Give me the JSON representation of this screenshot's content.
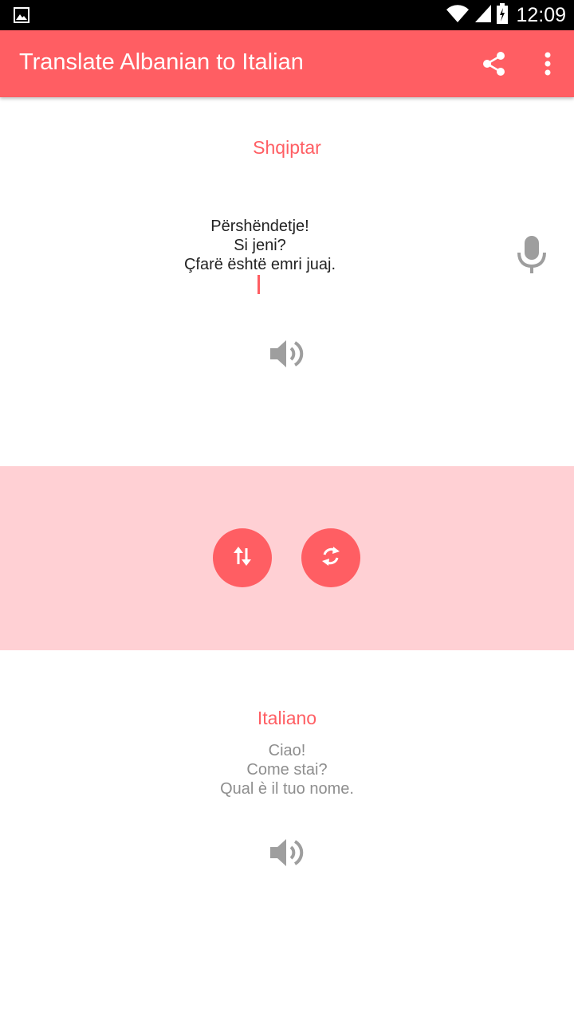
{
  "status_bar": {
    "time": "12:09",
    "icons": [
      "image-icon",
      "wifi-icon",
      "signal-icon",
      "battery-charging-icon"
    ]
  },
  "app_bar": {
    "title": "Translate Albanian to Italian",
    "actions": [
      "share-icon",
      "more-vert-icon"
    ],
    "background": "#ff5e63"
  },
  "source": {
    "language": "Shqiptar",
    "lines": [
      "Përshëndetje!",
      "Si jeni?",
      "Çfarë është emri juaj."
    ],
    "icons": [
      "mic-icon",
      "speaker-icon"
    ]
  },
  "controls": {
    "buttons": [
      "swap-languages-icon",
      "refresh-icon"
    ],
    "band_color": "#ffd0d4"
  },
  "target": {
    "language": "Italiano",
    "lines": [
      "Ciao!",
      "Come stai?",
      "Qual è il tuo nome."
    ],
    "icons": [
      "speaker-icon"
    ]
  }
}
